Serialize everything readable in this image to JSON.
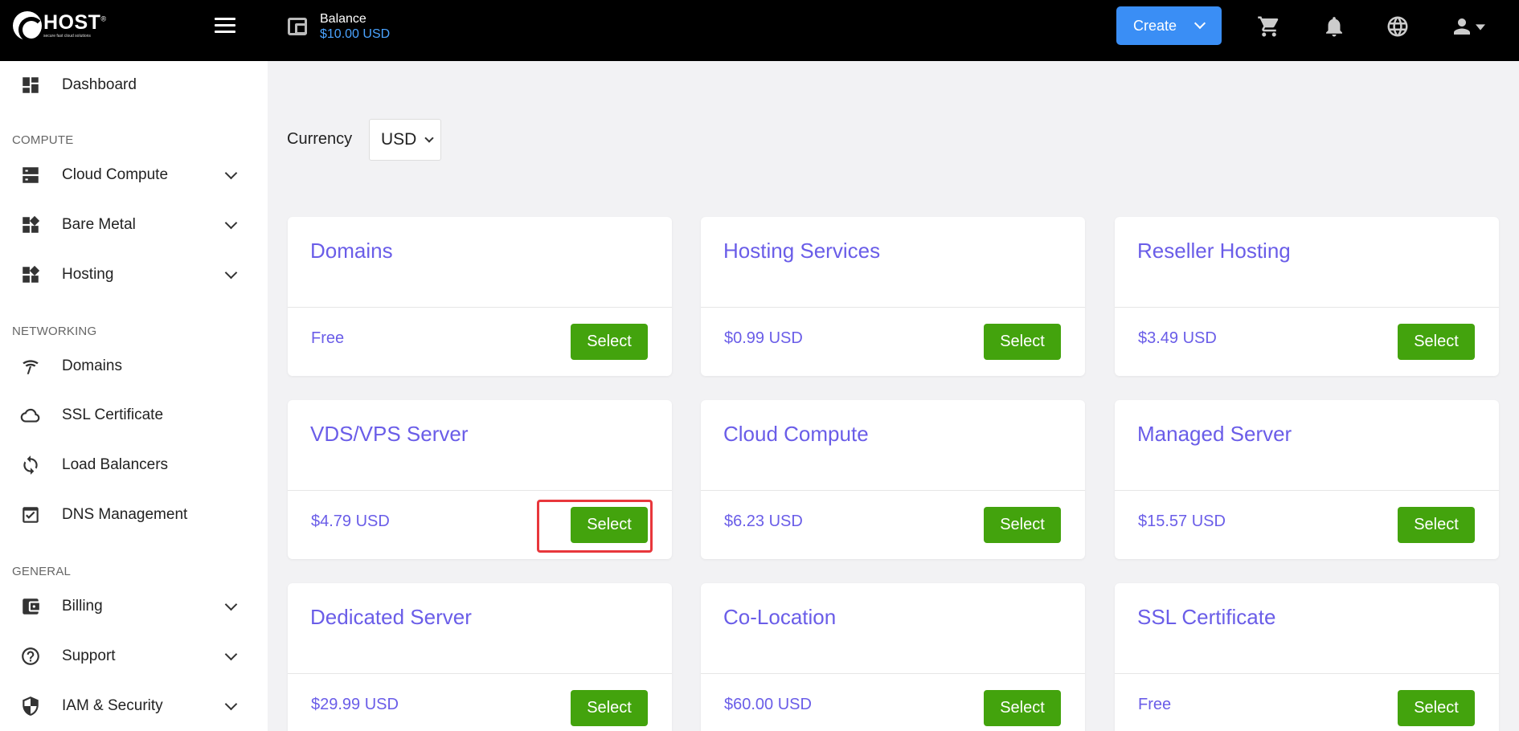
{
  "header": {
    "logo_text": "HOST",
    "logo_registered": "®",
    "logo_tagline": "secure fast cloud solutions",
    "balance_label": "Balance",
    "balance_amount": "$10.00 USD",
    "create_label": "Create",
    "icons": [
      "cart-icon",
      "bell-icon",
      "globe-icon",
      "user-icon"
    ]
  },
  "sidebar": {
    "dashboard": "Dashboard",
    "sections": {
      "compute": "COMPUTE",
      "networking": "NETWORKING",
      "general": "GENERAL"
    },
    "items": {
      "cloud_compute": "Cloud Compute",
      "bare_metal": "Bare Metal",
      "hosting": "Hosting",
      "domains": "Domains",
      "ssl": "SSL Certificate",
      "load_balancers": "Load Balancers",
      "dns": "DNS Management",
      "billing": "Billing",
      "support": "Support",
      "iam": "IAM & Security"
    }
  },
  "main": {
    "currency_label": "Currency",
    "currency_value": "USD",
    "select_label": "Select",
    "cards": [
      {
        "title": "Domains",
        "price": "Free"
      },
      {
        "title": "Hosting Services",
        "price": "$0.99 USD"
      },
      {
        "title": "Reseller Hosting",
        "price": "$3.49 USD"
      },
      {
        "title": "VDS/VPS Server",
        "price": "$4.79 USD"
      },
      {
        "title": "Cloud Compute",
        "price": "$6.23 USD"
      },
      {
        "title": "Managed Server",
        "price": "$15.57 USD"
      },
      {
        "title": "Dedicated Server",
        "price": "$29.99 USD"
      },
      {
        "title": "Co-Location",
        "price": "$60.00 USD"
      },
      {
        "title": "SSL Certificate",
        "price": "Free"
      }
    ]
  },
  "colors": {
    "accent": "#6a5de8",
    "select_green": "#43a30d",
    "create_blue": "#3a8ef5",
    "highlight_red": "#e8373c"
  }
}
